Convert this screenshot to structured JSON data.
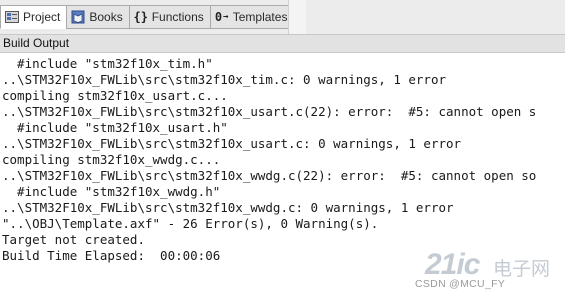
{
  "tabs": [
    {
      "label": "Project",
      "icon": "project-icon"
    },
    {
      "label": "Books",
      "icon": "books-icon"
    },
    {
      "label": "Functions",
      "icon": "functions-icon"
    },
    {
      "label": "Templates",
      "icon": "templates-icon"
    }
  ],
  "panel": {
    "title": "Build Output"
  },
  "output": {
    "lines": [
      "  #include \"stm32f10x_tim.h\"",
      "..\\STM32F10x_FWLib\\src\\stm32f10x_tim.c: 0 warnings, 1 error",
      "compiling stm32f10x_usart.c...",
      "..\\STM32F10x_FWLib\\src\\stm32f10x_usart.c(22): error:  #5: cannot open s",
      "  #include \"stm32f10x_usart.h\"",
      "..\\STM32F10x_FWLib\\src\\stm32f10x_usart.c: 0 warnings, 1 error",
      "compiling stm32f10x_wwdg.c...",
      "..\\STM32F10x_FWLib\\src\\stm32f10x_wwdg.c(22): error:  #5: cannot open so",
      "  #include \"stm32f10x_wwdg.h\"",
      "..\\STM32F10x_FWLib\\src\\stm32f10x_wwdg.c: 0 warnings, 1 error",
      "\"..\\OBJ\\Template.axf\" - 26 Error(s), 0 Warning(s).",
      "Target not created.",
      "Build Time Elapsed:  00:00:06"
    ]
  },
  "watermark": {
    "brand": "21ic",
    "cn": "电子网",
    "credit": "CSDN @MCU_FY"
  }
}
